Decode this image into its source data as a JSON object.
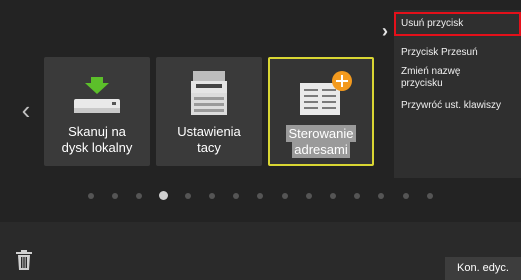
{
  "navigation": {
    "prev_arrow": "‹",
    "menu_arrow": "›"
  },
  "tiles": [
    {
      "label_line1": "Skanuj na",
      "label_line2": "dysk lokalny",
      "icon": "scan-to-drive-icon"
    },
    {
      "label_line1": "Ustawienia",
      "label_line2": "tacy",
      "icon": "printer-tray-icon"
    },
    {
      "label_line1": "Sterowanie",
      "label_line2": "adresami",
      "icon": "address-control-icon",
      "selected": true
    }
  ],
  "context_menu": {
    "items": [
      {
        "label": "Usuń przycisk",
        "highlighted": true
      },
      {
        "label": "Przycisk Przesuń"
      },
      {
        "label": "Zmień nazwę przycisku"
      },
      {
        "label": "Przywróć ust. klawiszy"
      }
    ]
  },
  "pagination": {
    "page_count": 15,
    "active_page": 4
  },
  "bottom_bar": {
    "trash_icon": "trash-icon",
    "done_label": "Kon. edyc."
  },
  "colors": {
    "selected_border": "#d9d633",
    "highlight_border": "#e4101a",
    "accent_orange": "#f39a1e",
    "accent_green": "#5cbf2a"
  }
}
